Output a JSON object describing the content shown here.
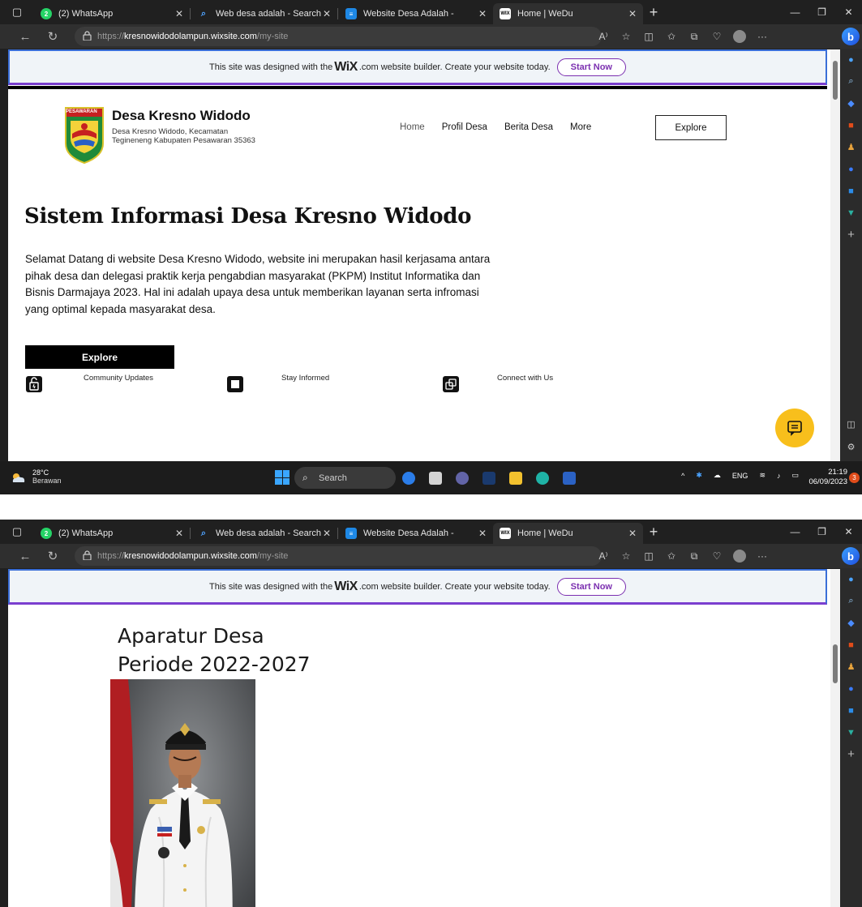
{
  "browser": {
    "tabs": [
      {
        "title": "(2) WhatsApp",
        "icon": "whatsapp-icon",
        "color": "#25d366",
        "badge": "2"
      },
      {
        "title": "Web desa adalah - Search",
        "icon": "bing-search-icon",
        "color": "#2b7de9"
      },
      {
        "title": "Website Desa Adalah -",
        "icon": "site-favicon",
        "color": "#1e88e5"
      },
      {
        "title": "Home | WeDu",
        "icon": "wix-favicon",
        "color": "#444444",
        "active": true
      }
    ],
    "url_scheme": "https://",
    "url_host": "kresnowidodolampun.wixsite.com",
    "url_path": "/my-site"
  },
  "wix_banner": {
    "text_before": "This site was designed with the",
    "brand": "WiX",
    "text_after": ".com website builder. Create your website today.",
    "cta": "Start Now"
  },
  "site": {
    "title": "Desa Kresno Widodo",
    "address": "Desa Kresno Widodo, Kecamatan Tegineneng Kabupaten Pesawaran 35363",
    "logo_caption": "PESAWARAN",
    "nav": [
      "Home",
      "Profil Desa",
      "Berita Desa",
      "More"
    ],
    "explore_top": "Explore",
    "hero_title": "Sistem Informasi Desa Kresno Widodo",
    "hero_text": "Selamat Datang di website Desa Kresno Widodo, website ini merupakan hasil kerjasama antara pihak desa dan delegasi praktik kerja pengabdian masyarakat (PKPM) Institut Informatika dan Bisnis Darmajaya 2023. Hal ini adalah upaya desa untuk memberikan layanan serta infromasi yang optimal kepada masyarakat desa.",
    "explore_button": "Explore",
    "features": [
      "Community Updates",
      "Stay Informed",
      "Connect with Us"
    ],
    "aparatur_line1": "Aparatur Desa",
    "aparatur_line2": "Periode 2022-2027"
  },
  "taskbar": {
    "temp": "28°C",
    "weather": "Berawan",
    "search_placeholder": "Search",
    "lang": "ENG",
    "time": "21:19",
    "date": "06/09/2023",
    "notifications": "3"
  },
  "colors": {
    "chat_fab": "#f8bf1c",
    "wix_accent": "#7b2fb0",
    "browser_dark": "#202020"
  }
}
